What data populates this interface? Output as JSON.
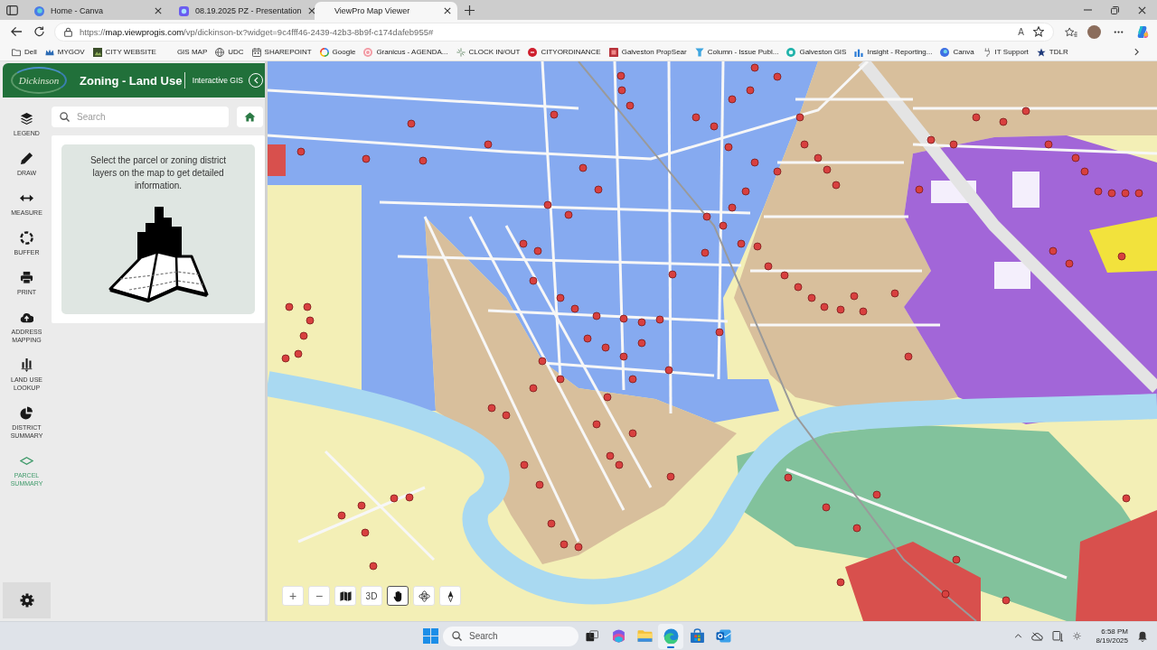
{
  "browser": {
    "tabs": [
      {
        "title": "Home - Canva",
        "selected": false
      },
      {
        "title": "08.19.2025 PZ - Presentation",
        "selected": false
      },
      {
        "title": "ViewPro Map Viewer",
        "selected": true
      }
    ],
    "address": {
      "url": "https://**map.viewprogis.com**/vp/dickinson-tx?widget=9c4fff46-2439-42b3-8b9f-c174dafeb955#",
      "read_aloud": "A"
    },
    "bookmarks": [
      "Dell",
      "MYGOV",
      "CITY WEBSITE",
      "GIS MAP",
      "UDC",
      "SHAREPOINT",
      "Google",
      "Granicus - AGENDA...",
      "CLOCK IN/OUT",
      "CITYORDINANCE",
      "Galveston PropSear",
      "Column - Issue Publ...",
      "Galveston GIS",
      "Insight - Reporting...",
      "Canva",
      "IT Support",
      "TDLR"
    ]
  },
  "app": {
    "logo": "Dickinson",
    "title": "Zoning - Land Use",
    "subtitle": "Interactive GIS",
    "tools": [
      {
        "label": "LEGEND",
        "selected": false
      },
      {
        "label": "DRAW",
        "selected": false
      },
      {
        "label": "MEASURE",
        "selected": false
      },
      {
        "label": "BUFFER",
        "selected": false
      },
      {
        "label": "PRINT",
        "selected": false
      },
      {
        "label": "ADDRESS MAPPING",
        "selected": false
      },
      {
        "label": "LAND USE LOOKUP",
        "selected": false
      },
      {
        "label": "DISTRICT SUMMARY",
        "selected": false
      },
      {
        "label": "PARCEL SUMMARY",
        "selected": true
      }
    ],
    "search": {
      "placeholder": "Search"
    },
    "info": {
      "message": "Select the parcel or zoning district layers on the map to get detailed information."
    },
    "map_controls": [
      {
        "kind": "zoomin",
        "label": "+",
        "selected": false
      },
      {
        "kind": "zoomout",
        "label": "−",
        "selected": false
      },
      {
        "kind": "basemap",
        "selected": false
      },
      {
        "kind": "perspective",
        "label": "3D",
        "selected": false
      },
      {
        "kind": "pan",
        "selected": true
      },
      {
        "kind": "orbit",
        "selected": false
      },
      {
        "kind": "compass",
        "selected": false
      }
    ]
  },
  "taskbar": {
    "search": {
      "placeholder": "Search"
    },
    "apps": [
      {
        "selected": false
      },
      {
        "selected": false
      },
      {
        "selected": true
      },
      {
        "selected": false
      },
      {
        "selected": false
      }
    ],
    "time": "6:58 PM",
    "date": "8/19/2025"
  }
}
